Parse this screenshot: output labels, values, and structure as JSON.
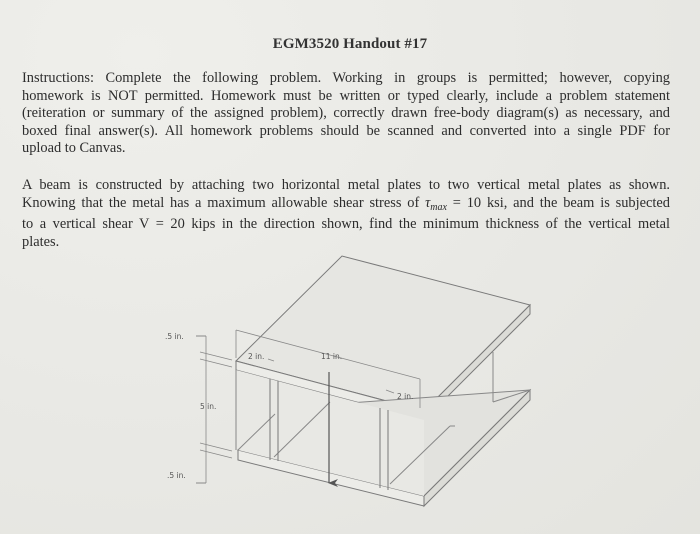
{
  "document": {
    "title": "EGM3520 Handout #17",
    "instructions": {
      "lines": [
        "Instructions: Complete the following problem. Working in groups is permitted; however, copying",
        "homework is NOT permitted. Homework must be written or typed clearly, include a problem statement",
        "(reiteration or summary of the assigned problem), correctly drawn free-body diagram(s) as necessary, and",
        "boxed final answer(s). All homework problems should be scanned and converted into a single PDF for",
        "upload to Canvas."
      ]
    },
    "problem": {
      "line1": "A beam is constructed by attaching two horizontal metal plates to two vertical metal plates as shown.",
      "line2_pre": "Knowing that the metal has a maximum allowable shear stress of ",
      "tau_symbol": "τ",
      "tau_subscript": "max",
      "line2_post": " = 10 ksi, and the beam is subjected",
      "line3": "to a vertical shear V = 20 kips in the direction shown, find the minimum thickness of the vertical metal",
      "line4": "plates."
    }
  },
  "diagram": {
    "labels": {
      "top_flange_thickness": ".5 in.",
      "web_height": "5 in.",
      "bottom_flange_thickness": ".5 in.",
      "left_web_offset": "2 in.",
      "flange_width": "11 in.",
      "right_web_offset": "2 in."
    },
    "shear_arrow": "V (downward)"
  }
}
